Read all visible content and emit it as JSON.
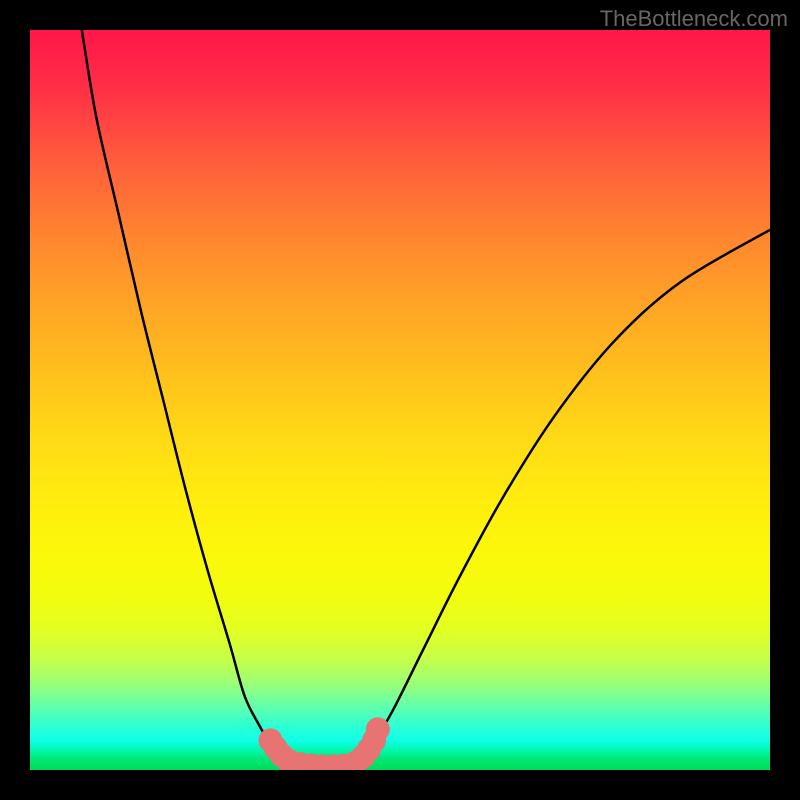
{
  "watermark": "TheBottleneck.com",
  "chart_data": {
    "type": "line",
    "title": "",
    "xlabel": "",
    "ylabel": "",
    "xlim": [
      0,
      100
    ],
    "ylim": [
      0,
      100
    ],
    "series": [
      {
        "name": "left-curve",
        "x": [
          7,
          9,
          12,
          15,
          18,
          21,
          24,
          27,
          29,
          31,
          32.5,
          34,
          35.5,
          37
        ],
        "values": [
          100,
          88,
          75,
          62,
          50,
          38,
          27,
          17,
          10,
          6,
          3.5,
          2,
          1,
          0.5
        ]
      },
      {
        "name": "right-curve",
        "x": [
          44,
          46,
          49,
          53,
          58,
          64,
          71,
          79,
          88,
          100
        ],
        "values": [
          0.5,
          3,
          8,
          16,
          26,
          37,
          48,
          58,
          66,
          73
        ]
      }
    ],
    "markers": [
      {
        "x": 32.5,
        "y": 4.0,
        "r": 1.2
      },
      {
        "x": 33.2,
        "y": 3.0,
        "r": 1.2
      },
      {
        "x": 34.0,
        "y": 2.0,
        "r": 1.2
      },
      {
        "x": 35.0,
        "y": 1.2,
        "r": 1.2
      },
      {
        "x": 36.5,
        "y": 0.8,
        "r": 1.2
      },
      {
        "x": 38.0,
        "y": 0.6,
        "r": 1.2
      },
      {
        "x": 39.5,
        "y": 0.5,
        "r": 1.2
      },
      {
        "x": 41.0,
        "y": 0.5,
        "r": 1.2
      },
      {
        "x": 42.5,
        "y": 0.6,
        "r": 1.2
      },
      {
        "x": 44.0,
        "y": 1.0,
        "r": 1.2
      },
      {
        "x": 45.0,
        "y": 1.8,
        "r": 1.2
      },
      {
        "x": 45.8,
        "y": 2.8,
        "r": 1.2
      },
      {
        "x": 46.5,
        "y": 4.0,
        "r": 1.2
      },
      {
        "x": 47.0,
        "y": 5.5,
        "r": 1.2
      }
    ],
    "gradient_stops": [
      {
        "pos": 0,
        "color": "#ff1749"
      },
      {
        "pos": 50,
        "color": "#ffd400"
      },
      {
        "pos": 100,
        "color": "#00dc58"
      }
    ]
  }
}
